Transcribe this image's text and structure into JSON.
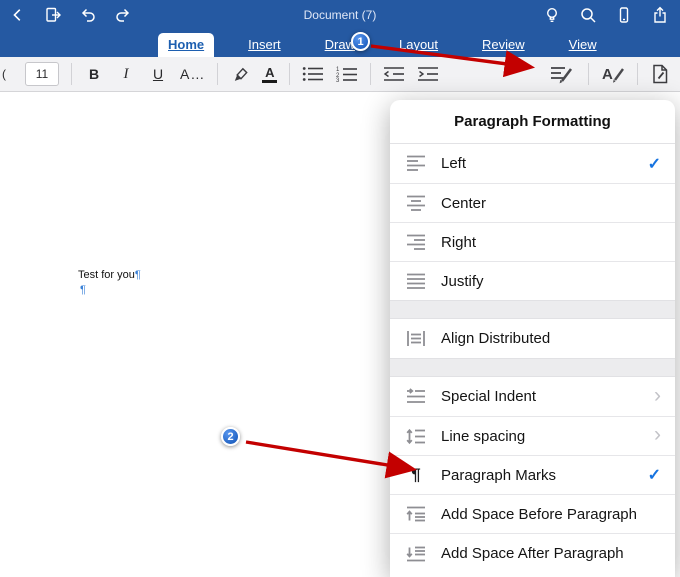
{
  "titlebar": {
    "title": "Document (7)"
  },
  "tabs": {
    "items": [
      {
        "label": "Home",
        "selected": true
      },
      {
        "label": "Insert"
      },
      {
        "label": "Draw"
      },
      {
        "label": "Layout"
      },
      {
        "label": "Review"
      },
      {
        "label": "View"
      }
    ]
  },
  "toolbar": {
    "font_name_partial": "(",
    "font_size": "11",
    "bold": "B",
    "italic": "I",
    "underline": "U",
    "more_formatting": "A…",
    "font_color_letter": "A"
  },
  "document": {
    "line1": "Test for you",
    "pilcrow": "¶"
  },
  "menu": {
    "title": "Paragraph Formatting",
    "sections": [
      {
        "items": [
          {
            "label": "Left",
            "checked": true
          },
          {
            "label": "Center"
          },
          {
            "label": "Right"
          },
          {
            "label": "Justify"
          }
        ]
      },
      {
        "items": [
          {
            "label": "Align Distributed"
          }
        ]
      },
      {
        "items": [
          {
            "label": "Special Indent",
            "submenu": true
          },
          {
            "label": "Line spacing",
            "submenu": true
          },
          {
            "label": "Paragraph Marks",
            "checked": true
          },
          {
            "label": "Add Space Before Paragraph"
          },
          {
            "label": "Add Space After Paragraph"
          }
        ]
      }
    ]
  },
  "icons": {
    "check": "✓",
    "chevron": "›",
    "pilcrow": "¶"
  },
  "annotations": {
    "badge1": "1",
    "badge2": "2"
  }
}
